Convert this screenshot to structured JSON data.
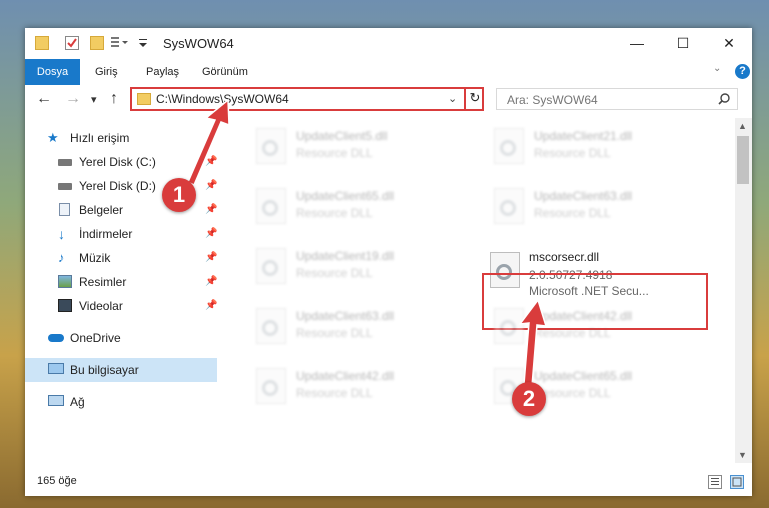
{
  "window": {
    "title": "SysWOW64",
    "controls": {
      "minimize": "—",
      "maximize": "☐",
      "close": "✕"
    }
  },
  "ribbon": {
    "tabs": [
      "Dosya",
      "Giriş",
      "Paylaş",
      "Görünüm"
    ],
    "active_tab": "Dosya",
    "help": "?"
  },
  "navigation": {
    "back": "←",
    "forward": "→",
    "recent": "▾",
    "up": "↑",
    "address": "C:\\Windows\\SysWOW64",
    "refresh": "↻"
  },
  "search": {
    "placeholder": "Ara: SysWOW64"
  },
  "sidebar": {
    "items": [
      {
        "label": "Hızlı erişim",
        "icon": "star-icon"
      },
      {
        "label": "Yerel Disk (C:)",
        "icon": "drive-icon",
        "pinned": true
      },
      {
        "label": "Yerel Disk (D:)",
        "icon": "drive-icon",
        "pinned": true
      },
      {
        "label": "Belgeler",
        "icon": "documents-icon",
        "pinned": true
      },
      {
        "label": "İndirmeler",
        "icon": "download-icon",
        "pinned": true
      },
      {
        "label": "Müzik",
        "icon": "music-icon",
        "pinned": true
      },
      {
        "label": "Resimler",
        "icon": "pictures-icon",
        "pinned": true
      },
      {
        "label": "Videolar",
        "icon": "video-icon",
        "pinned": true
      },
      {
        "label": "OneDrive",
        "icon": "cloud-icon"
      },
      {
        "label": "Bu bilgisayar",
        "icon": "computer-icon",
        "selected": true
      },
      {
        "label": "Ağ",
        "icon": "network-icon"
      }
    ]
  },
  "files": [
    {
      "name": "UpdateClient5.dll",
      "type": "Resource DLL"
    },
    {
      "name": "UpdateClient21.dll",
      "type": "Resource DLL"
    },
    {
      "name": "UpdateClient65.dll",
      "type": "Resource DLL"
    },
    {
      "name": "UpdateClient63.dll",
      "type": "Resource DLL"
    },
    {
      "name": "UpdateClient19.dll",
      "type": "Resource DLL"
    },
    {
      "name": "mscorsecr.dll",
      "version": "2.0.50727.4918",
      "type": "Microsoft .NET Secu...",
      "highlighted": true
    },
    {
      "name": "UpdateClient63.dll",
      "type": "Resource DLL"
    },
    {
      "name": "UpdateClient42.dll",
      "type": "Resource DLL"
    },
    {
      "name": "UpdateClient42.dll",
      "type": "Resource DLL"
    },
    {
      "name": "UpdateClient65.dll",
      "type": "Resource DLL"
    }
  ],
  "status": {
    "count": "165 öğe"
  },
  "annotations": {
    "one": "1",
    "two": "2"
  },
  "colors": {
    "accent": "#1979ca",
    "highlight": "#d93c3c",
    "selection": "#cce4f7"
  }
}
